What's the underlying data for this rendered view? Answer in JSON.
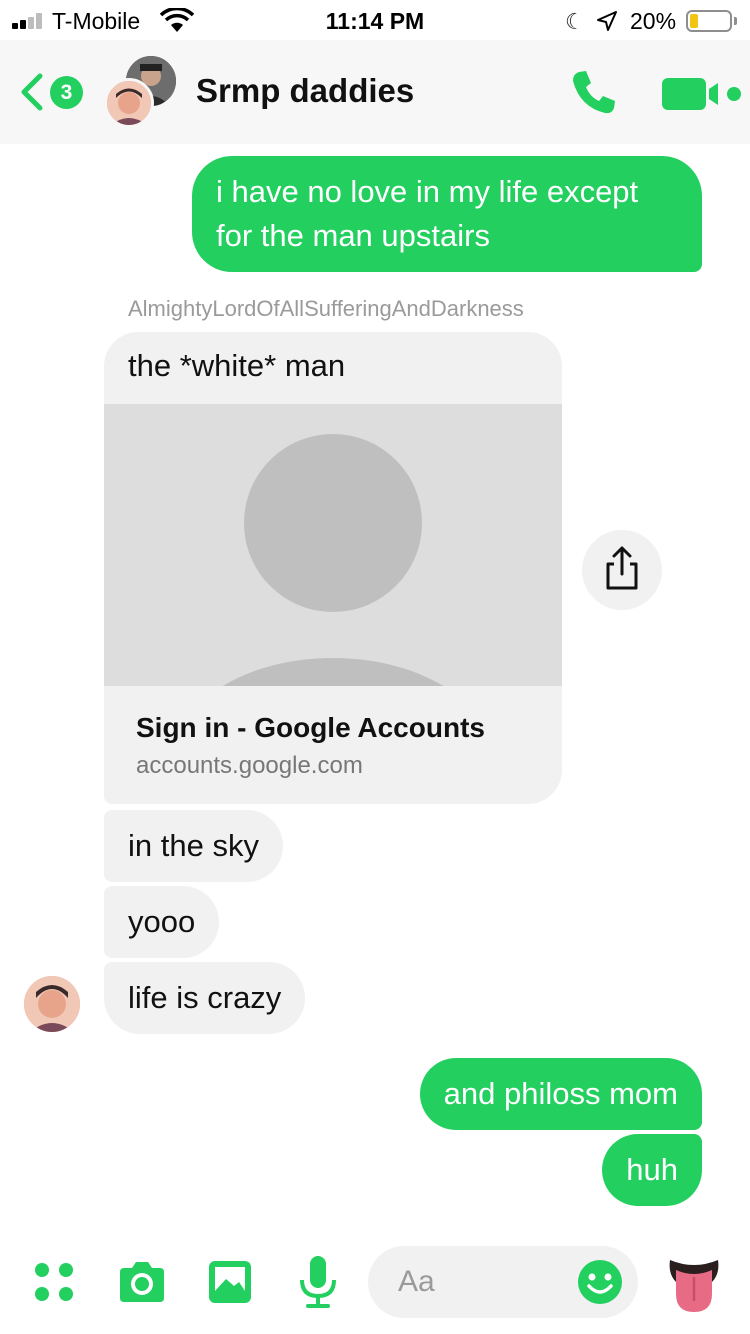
{
  "status_bar": {
    "carrier": "T-Mobile",
    "time": "11:14 PM",
    "battery_percent": "20%",
    "battery_level": 0.2
  },
  "header": {
    "back_badge": "3",
    "title": "Srmp daddies"
  },
  "messages": {
    "m1": "i have no love in my life except\nfor the man upstairs",
    "sender_name": "AlmightyLordOfAllSufferingAndDarkness",
    "link_card": {
      "text": "the *white* man",
      "title": "Sign in - Google Accounts",
      "domain": "accounts.google.com"
    },
    "m3": "in the sky",
    "m4": "yooo",
    "m5": "life is crazy",
    "m6": "and philoss mom",
    "m7": "huh"
  },
  "composer": {
    "placeholder": "Aa"
  },
  "colors": {
    "accent": "#23cf5f",
    "incoming_bubble": "#f1f1f1",
    "header_bg": "#f7f7f7"
  },
  "icons": {
    "toolbar": [
      "apps-icon",
      "camera-icon",
      "gallery-icon",
      "microphone-icon",
      "emoji-icon",
      "tongue-emoji-icon"
    ],
    "header": [
      "back-chevron-icon",
      "phone-icon",
      "video-camera-icon"
    ]
  }
}
